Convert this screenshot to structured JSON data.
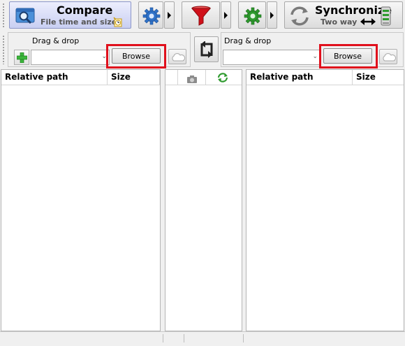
{
  "toolbar": {
    "compare": {
      "title": "Compare",
      "subtitle": "File time and size"
    },
    "synchronize": {
      "title": "Synchronize",
      "subtitle": "Two way"
    }
  },
  "folders": {
    "left": {
      "drag_label": "Drag & drop",
      "path_value": "",
      "browse_label": "Browse"
    },
    "right": {
      "drag_label": "Drag & drop",
      "path_value": "",
      "browse_label": "Browse"
    }
  },
  "left_grid": {
    "columns": [
      "Relative path",
      "Size"
    ]
  },
  "right_grid": {
    "columns": [
      "Relative path",
      "Size"
    ]
  },
  "icons": {
    "compare": "magnifier-window-icon",
    "compare_settings": "gear-blue-icon",
    "filter": "funnel-icon",
    "sync_settings": "gear-green-icon",
    "synchronize": "sync-arrows-icon",
    "add_folder_pair": "plus-icon",
    "swap": "swap-icon",
    "cloud": "cloud-icon"
  },
  "colors": {
    "highlight": "#e0101c",
    "compare_bg": "#c9cff2",
    "filter_red": "#d0101a",
    "gear_blue": "#2f72c8",
    "gear_green": "#2e9a2e"
  }
}
